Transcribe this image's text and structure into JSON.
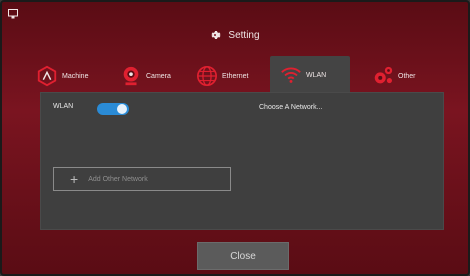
{
  "header": {
    "title": "Setting",
    "icon": "gear-icon"
  },
  "tabs": [
    {
      "label": "Machine",
      "icon": "machine-icon",
      "active": false
    },
    {
      "label": "Camera",
      "icon": "camera-icon",
      "active": false
    },
    {
      "label": "Ethernet",
      "icon": "globe-icon",
      "active": false
    },
    {
      "label": "WLAN",
      "icon": "wifi-icon",
      "active": true
    },
    {
      "label": "Other",
      "icon": "gears-icon",
      "active": false
    }
  ],
  "wlan": {
    "label": "WLAN",
    "toggle_on": true,
    "choose_network": "Choose A Network..."
  },
  "add_network": {
    "label": "Add Other Network",
    "icon": "plus-icon"
  },
  "footer": {
    "close_label": "Close"
  },
  "colors": {
    "frame": "#7a1420",
    "accent": "#e02030",
    "toggle": "#2a8bd6",
    "panel": "#3f3f3f"
  }
}
